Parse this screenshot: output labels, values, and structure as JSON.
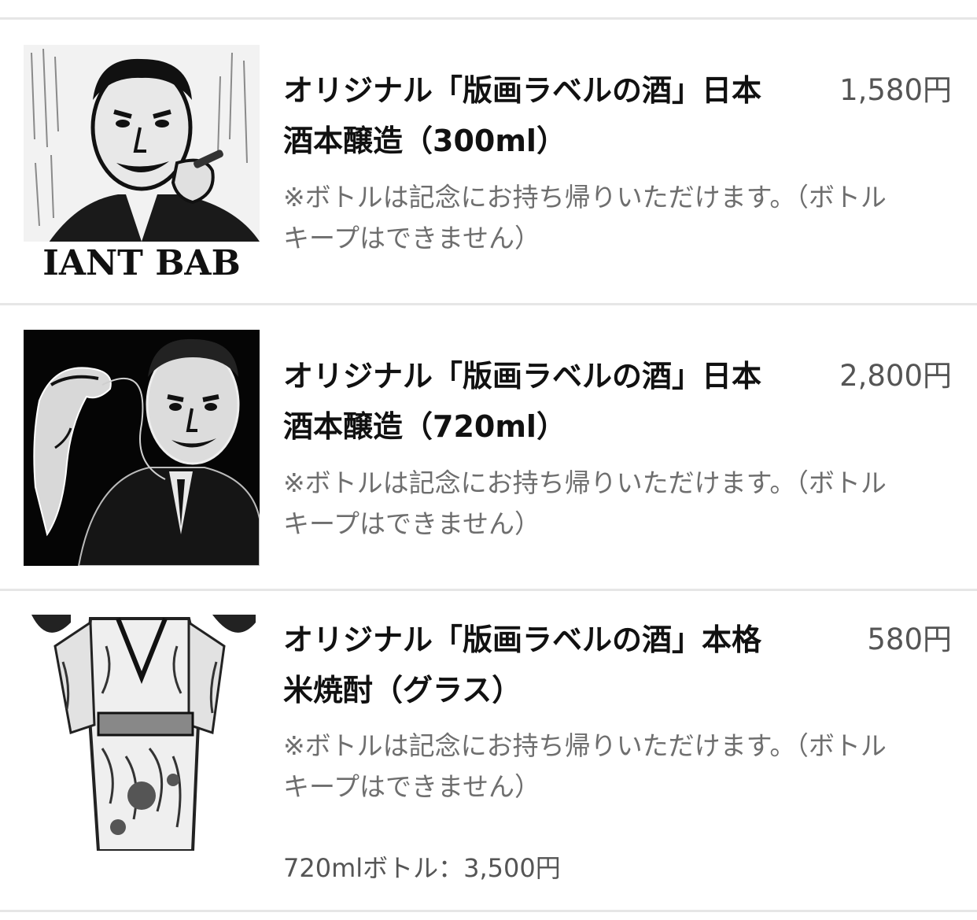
{
  "items": [
    {
      "title_line1": "オリジナル「版画ラベルの酒」日本",
      "title_line2": "酒本醸造（300ml）",
      "price": "1,580円",
      "note_line1": "※ボトルは記念にお持ち帰りいただけます。（ボトル",
      "note_line2": "キープはできません）",
      "image_caption": "IANT BAB"
    },
    {
      "title_line1": "オリジナル「版画ラベルの酒」日本",
      "title_line2": "酒本醸造（720ml）",
      "price": "2,800円",
      "note_line1": "※ボトルは記念にお持ち帰りいただけます。（ボトル",
      "note_line2": "キープはできません）"
    },
    {
      "title_line1": "オリジナル「版画ラベルの酒」本格",
      "title_line2": "米焼酎（グラス）",
      "price": "580円",
      "note_line1": "※ボトルは記念にお持ち帰りいただけます。（ボトル",
      "note_line2": "キープはできません）",
      "extra": "720mlボトル：3,500円"
    }
  ],
  "colors": {
    "divider": "#e6e6e6",
    "title": "#111111",
    "price": "#555555",
    "note": "#6e6e6e"
  }
}
